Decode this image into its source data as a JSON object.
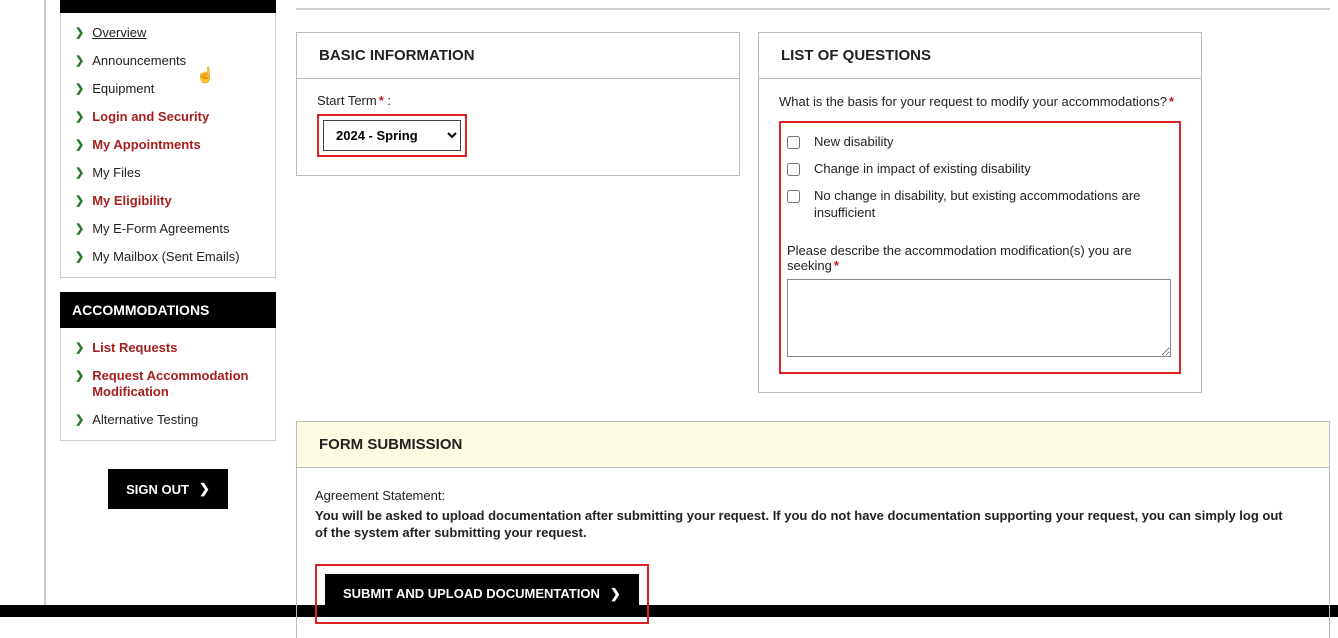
{
  "sidebar": {
    "primary": {
      "items": [
        {
          "label": "Overview",
          "active": true,
          "red": false
        },
        {
          "label": "Announcements",
          "active": false,
          "red": false
        },
        {
          "label": "Equipment",
          "active": false,
          "red": false
        },
        {
          "label": "Login and Security",
          "active": false,
          "red": true
        },
        {
          "label": "My Appointments",
          "active": false,
          "red": true
        },
        {
          "label": "My Files",
          "active": false,
          "red": false
        },
        {
          "label": "My Eligibility",
          "active": false,
          "red": true
        },
        {
          "label": "My E-Form Agreements",
          "active": false,
          "red": false
        },
        {
          "label": "My Mailbox (Sent Emails)",
          "active": false,
          "red": false
        }
      ]
    },
    "accommodations": {
      "header": "ACCOMMODATIONS",
      "items": [
        {
          "label": "List Requests",
          "red": true
        },
        {
          "label": "Request Accommodation Modification",
          "red": true
        },
        {
          "label": "Alternative Testing",
          "red": false
        }
      ]
    },
    "signout_label": "SIGN OUT"
  },
  "basic_info": {
    "header": "BASIC INFORMATION",
    "start_term_label": "Start Term",
    "start_term_value": "2024 - Spring"
  },
  "questions": {
    "header": "LIST OF QUESTIONS",
    "prompt": "What is the basis for your request to modify your accommodations?",
    "options": [
      "New disability",
      "Change in impact of existing disability",
      "No change in disability, but existing accommodations are insufficient"
    ],
    "describe_label": "Please describe the accommodation modification(s) you are seeking"
  },
  "submission": {
    "header": "FORM SUBMISSION",
    "agreement_label": "Agreement Statement:",
    "agreement_text": "You will be asked to upload documentation after submitting your request. If you do not have documentation supporting your request, you can simply log out of the system after submitting your request.",
    "submit_label": "SUBMIT AND UPLOAD DOCUMENTATION"
  }
}
